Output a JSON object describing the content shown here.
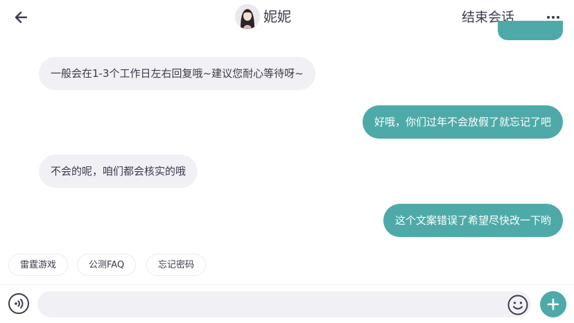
{
  "header": {
    "title": "妮妮",
    "end_session_label": "结束会话",
    "back_icon": "arrow-left-icon",
    "more_icon": "more-horizontal-icon"
  },
  "messages": [
    {
      "side": "left",
      "text": "一般会在1-3个工作日左右回复哦~建议您耐心等待呀~"
    },
    {
      "side": "right",
      "text": "好哦，你们过年不会放假了就忘记了吧"
    },
    {
      "side": "left",
      "text": "不会的呢，咱们都会核实的哦"
    },
    {
      "side": "right",
      "text": "这个文案错误了希望尽快改一下哟"
    }
  ],
  "quick_replies": [
    "雷霆游戏",
    "公测FAQ",
    "忘记密码"
  ],
  "input_bar": {
    "placeholder": "",
    "voice_icon": "voice-icon",
    "emoji_icon": "emoji-icon",
    "plus_icon": "plus-icon"
  },
  "colors": {
    "accent": "#4eaaa8",
    "incoming_bubble": "#f1f1f5",
    "text": "#3a3a4a"
  }
}
